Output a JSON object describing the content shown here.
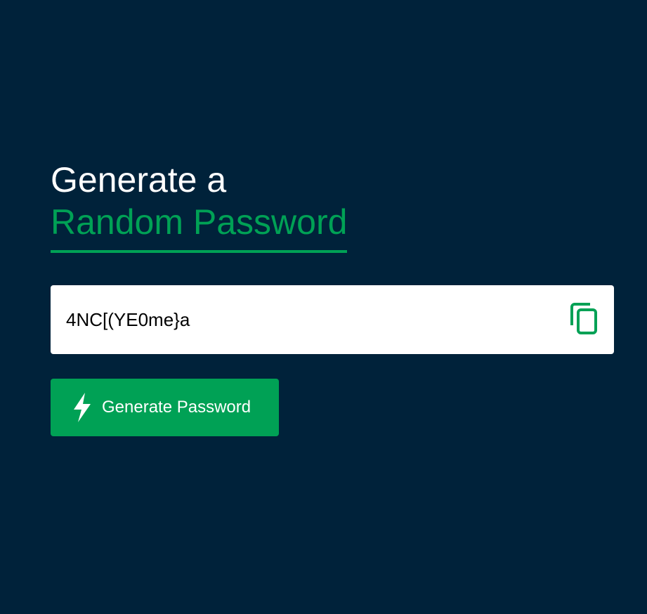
{
  "heading": {
    "line1": "Generate a",
    "line2": "Random Password"
  },
  "password": {
    "value": "4NC[(YE0me}a",
    "copy_icon": "copy-icon"
  },
  "generate_button": {
    "label": "Generate Password",
    "icon": "bolt-icon"
  },
  "colors": {
    "background": "#00223a",
    "accent": "#00a155",
    "text_light": "#ffffff",
    "field_background": "#ffffff"
  }
}
